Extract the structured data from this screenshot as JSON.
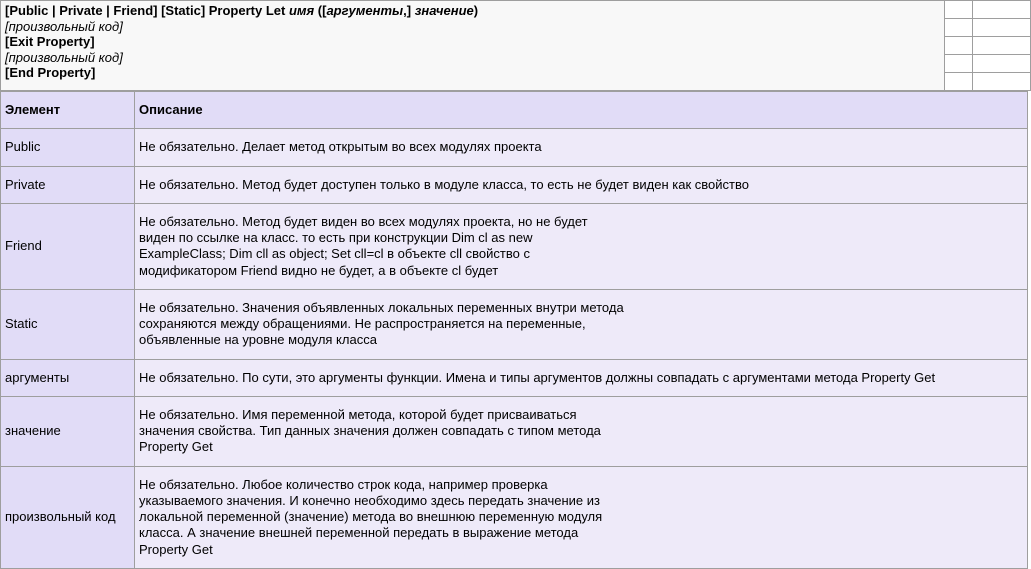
{
  "syntax": {
    "line1_a": "[Public | Private | Friend] [Static] Property Let ",
    "line1_b": "имя",
    "line1_c": " ([",
    "line1_d": "аргументы",
    "line1_e": ",] ",
    "line1_f": "значение",
    "line1_g": ")",
    "line2": "[произвольный код]",
    "line3": "[Exit Property]",
    "line4": "[произвольный код]",
    "line5": "[End Property]"
  },
  "table": {
    "head": {
      "c0": "Элемент",
      "c1": "Описание"
    },
    "rows": [
      {
        "c0": "Public",
        "c1": "Не обязательно. Делает метод открытым во всех модулях проекта"
      },
      {
        "c0": "Private",
        "c1": "Не обязательно. Метод будет доступен только в модуле класса, то есть не будет виден как свойство"
      },
      {
        "c0": "Friend",
        "c1": "Не обязательно. Метод будет виден во всех модулях проекта, но не будет\nвиден по ссылке на класс. то есть при конструкции Dim cl as new\nExampleClass; Dim cll as object; Set cll=cl в объекте cll свойство с\nмодификатором Friend видно не будет, а в объекте cl будет"
      },
      {
        "c0": "Static",
        "c1": "Не обязательно. Значения объявленных локальных переменных внутри метода\nсохраняются между обращениями. Не распространяется на переменные,\nобъявленные на уровне модуля класса"
      },
      {
        "c0": "аргументы",
        "c1": "Не обязательно. По сути, это аргументы функции. Имена и типы аргументов должны совпадать с аргументами метода Property Get"
      },
      {
        "c0": "значение",
        "c1": "Не обязательно. Имя переменной метода, которой будет присваиваться\nзначения свойства. Тип данных значения должен совпадать с типом метода\nProperty Get"
      },
      {
        "c0": "произвольный код",
        "c1": "Не обязательно. Любое количество строк кода, например проверка\nуказываемого значения. И конечно необходимо здесь передать значение из\nлокальной переменной (значение) метода во внешнюю переменную модуля\nкласса. А значение внешней переменной передать в выражение метода\nProperty Get"
      }
    ]
  }
}
